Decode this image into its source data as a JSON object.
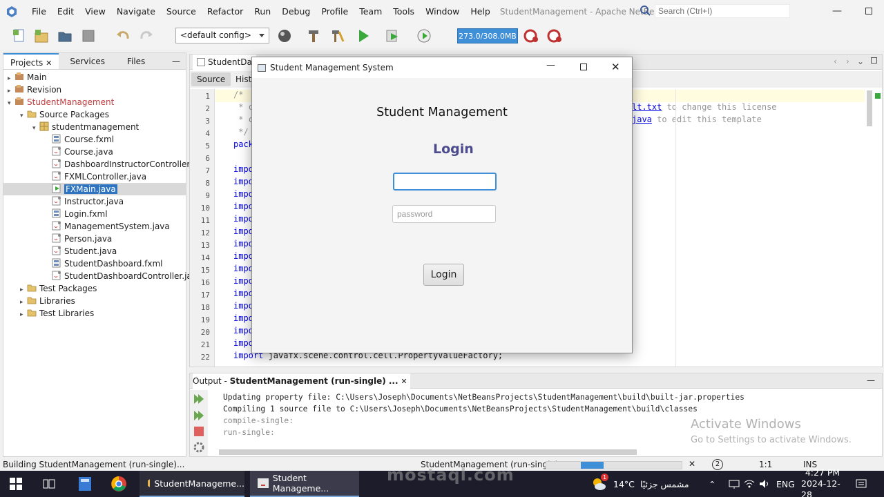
{
  "menubar": {
    "items": [
      "File",
      "Edit",
      "View",
      "Navigate",
      "Source",
      "Refactor",
      "Run",
      "Debug",
      "Profile",
      "Team",
      "Tools",
      "Window",
      "Help"
    ],
    "window_title": "StudentManagement - Apache NetBeans IDE ...",
    "search_placeholder": "Search (Ctrl+I)"
  },
  "toolbar": {
    "config": "<default config>",
    "memory": "273.0/308.0MB"
  },
  "projects_panel": {
    "tabs": [
      "Projects",
      "Services",
      "Files"
    ],
    "tree": [
      {
        "label": "Main",
        "level": 0,
        "icon": "project-icon",
        "expand": "▸"
      },
      {
        "label": "Revision",
        "level": 0,
        "icon": "project-icon",
        "expand": "▸"
      },
      {
        "label": "StudentManagement",
        "level": 0,
        "icon": "project-icon",
        "expand": "▾",
        "highlight": "#c04040"
      },
      {
        "label": "Source Packages",
        "level": 1,
        "icon": "folder-icon",
        "expand": "▾"
      },
      {
        "label": "studentmanagement",
        "level": 2,
        "icon": "package-icon",
        "expand": "▾"
      },
      {
        "label": "Course.fxml",
        "level": 3,
        "icon": "fxml-icon"
      },
      {
        "label": "Course.java",
        "level": 3,
        "icon": "java-file-icon"
      },
      {
        "label": "DashboardInstructorController.j",
        "level": 3,
        "icon": "java-file-icon"
      },
      {
        "label": "FXMLController.java",
        "level": 3,
        "icon": "java-file-icon"
      },
      {
        "label": "FXMain.java",
        "level": 3,
        "icon": "java-main-icon",
        "selected": true
      },
      {
        "label": "Instructor.java",
        "level": 3,
        "icon": "java-file-icon"
      },
      {
        "label": "Login.fxml",
        "level": 3,
        "icon": "fxml-icon"
      },
      {
        "label": "ManagementSystem.java",
        "level": 3,
        "icon": "java-file-icon"
      },
      {
        "label": "Person.java",
        "level": 3,
        "icon": "java-file-icon"
      },
      {
        "label": "Student.java",
        "level": 3,
        "icon": "java-file-icon"
      },
      {
        "label": "StudentDashboard.fxml",
        "level": 3,
        "icon": "fxml-icon"
      },
      {
        "label": "StudentDashboardController.jav",
        "level": 3,
        "icon": "java-file-icon"
      },
      {
        "label": "Test Packages",
        "level": 1,
        "icon": "folder-icon",
        "expand": "▸"
      },
      {
        "label": "Libraries",
        "level": 1,
        "icon": "folder-icon",
        "expand": "▸"
      },
      {
        "label": "Test Libraries",
        "level": 1,
        "icon": "folder-icon",
        "expand": "▸"
      }
    ]
  },
  "editor": {
    "tab": "StudentDa",
    "source_tab": "Source",
    "history_tab": "Histo",
    "line_numbers": [
      "1",
      "2",
      "3",
      "4",
      "5",
      "6",
      "7",
      "8",
      "9",
      "10",
      "11",
      "12",
      "13",
      "14",
      "15",
      "16",
      "17",
      "18",
      "19",
      "20",
      "21",
      "22"
    ],
    "lines": [
      {
        "text": "/*",
        "cls": "cm"
      },
      {
        "text": " * c",
        "cls": "cm"
      },
      {
        "text": " * c",
        "cls": "cm"
      },
      {
        "text": " */",
        "cls": "cm"
      },
      {
        "text": "pack",
        "cls": "kw"
      },
      {
        "text": "",
        "cls": ""
      },
      {
        "text": "impo",
        "cls": "kw"
      },
      {
        "text": "impo",
        "cls": "kw"
      },
      {
        "text": "impo",
        "cls": "kw"
      },
      {
        "text": "impo",
        "cls": "kw"
      },
      {
        "text": "impo",
        "cls": "kw"
      },
      {
        "text": "impo",
        "cls": "kw"
      },
      {
        "text": "impo",
        "cls": "kw"
      },
      {
        "text": "impo",
        "cls": "kw"
      },
      {
        "text": "impo",
        "cls": "kw"
      },
      {
        "text": "impo",
        "cls": "kw"
      },
      {
        "text": "impo",
        "cls": "kw"
      },
      {
        "text": "impo",
        "cls": "kw"
      },
      {
        "text": "impo",
        "cls": "kw"
      },
      {
        "text": "impo",
        "cls": "kw"
      },
      {
        "text": "impo",
        "cls": "kw"
      }
    ],
    "line22_kw": "import",
    "line22_rest": " javafx.scene.control.cell.PropertyValueFactory;",
    "right_line2_link": "lt.txt",
    "right_line2_rest": " to change this license",
    "right_line3_link": "java",
    "right_line3_rest": " to edit this template"
  },
  "output": {
    "tab_prefix": "Output - ",
    "tab_name": "StudentManagement (run-single) ...",
    "lines": [
      {
        "text": "Updating property file: C:\\Users\\Joseph\\Documents\\NetBeansProjects\\StudentManagement\\build\\built-jar.properties",
        "color": "#222"
      },
      {
        "text": "Compiling 1 source file to C:\\Users\\Joseph\\Documents\\NetBeansProjects\\StudentManagement\\build\\classes",
        "color": "#222"
      },
      {
        "text": "compile-single:",
        "color": "#888"
      },
      {
        "text": "run-single:",
        "color": "#888"
      }
    ],
    "activate_title": "Activate Windows",
    "activate_sub": "Go to Settings to activate Windows."
  },
  "statusbar": {
    "left": "Building StudentManagement (run-single)...",
    "task": "StudentManagement (run-single)",
    "badge": "2",
    "position": "1:1",
    "mode": "INS"
  },
  "dialog": {
    "title": "Student Management System",
    "heading": "Student Management",
    "login_title": "Login",
    "username_value": "",
    "password_placeholder": "password",
    "login_button": "Login"
  },
  "taskbar": {
    "app1": "StudentManageme...",
    "app2": "Student Manageme...",
    "temperature": "14°C",
    "weather": "مشمس جزئيًا",
    "lang": "ENG",
    "time": "4:27 PM",
    "date": "2024-12-28",
    "weather_badge": "1"
  },
  "watermark": "mostaql.com"
}
